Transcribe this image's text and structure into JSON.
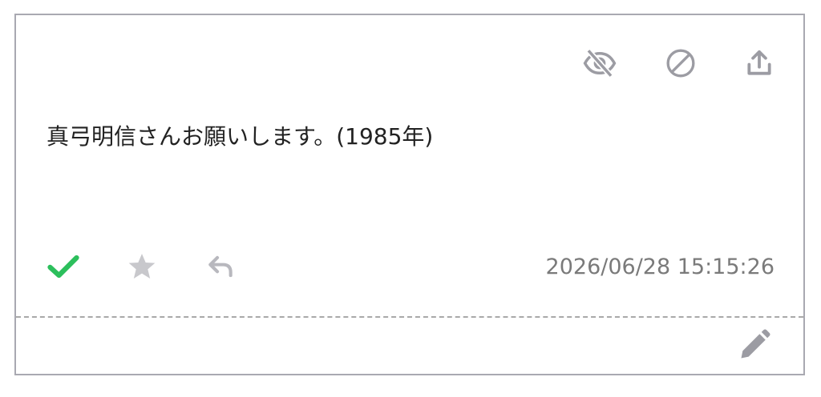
{
  "message": {
    "text": "真弓明信さんお願いします。(1985年)",
    "timestamp": "2026/06/28 15:15:26"
  },
  "top_actions": [
    {
      "name": "hide",
      "icon": "eye-off-icon"
    },
    {
      "name": "block",
      "icon": "block-icon"
    },
    {
      "name": "share",
      "icon": "upload-icon"
    }
  ],
  "bottom_actions": [
    {
      "name": "check",
      "icon": "check-icon",
      "color": "#2cbf5c"
    },
    {
      "name": "star",
      "icon": "star-icon",
      "color": "#c8c8cc"
    },
    {
      "name": "reply",
      "icon": "reply-icon",
      "color": "#b8b8be"
    }
  ],
  "footer": {
    "edit_icon": "pencil-icon"
  },
  "colors": {
    "border": "#a9a9b1",
    "icon_gray": "#9c9ca3",
    "text": "#222222",
    "timestamp": "#7a7a7a",
    "accent_green": "#2cbf5c"
  }
}
